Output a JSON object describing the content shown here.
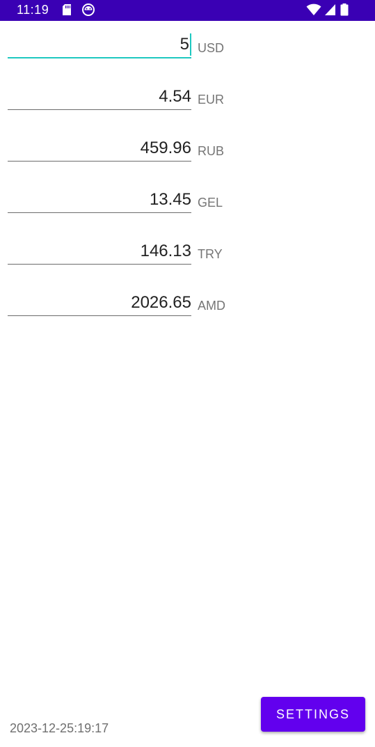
{
  "status_bar": {
    "time": "11:19",
    "bg_color": "#3a00b4",
    "icons": [
      "sd-card-icon",
      "android-icon",
      "wifi-icon",
      "signal-icon",
      "battery-icon"
    ]
  },
  "converter": {
    "rows": [
      {
        "value": "5",
        "code": "USD",
        "focused": true
      },
      {
        "value": "4.54",
        "code": "EUR",
        "focused": false
      },
      {
        "value": "459.96",
        "code": "RUB",
        "focused": false
      },
      {
        "value": "13.45",
        "code": "GEL",
        "focused": false
      },
      {
        "value": "146.13",
        "code": "TRY",
        "focused": false
      },
      {
        "value": "2026.65",
        "code": "AMD",
        "focused": false
      }
    ],
    "focus_color": "#1ec8c0"
  },
  "footer": {
    "timestamp": "2023-12-25:19:17",
    "settings_label": "SETTINGS",
    "accent_color": "#6200ee"
  }
}
